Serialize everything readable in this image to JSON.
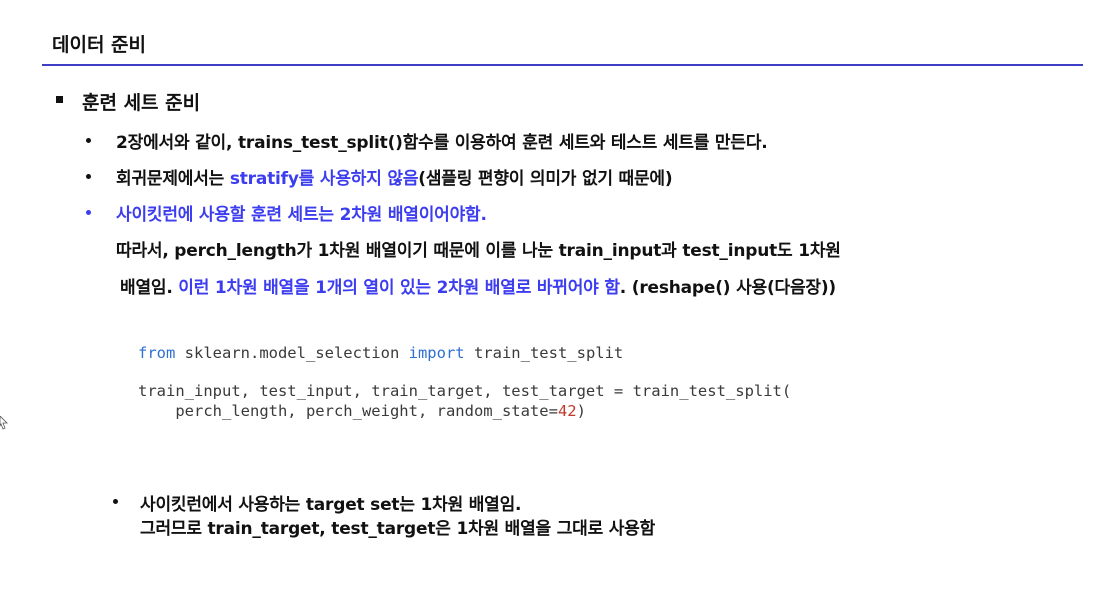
{
  "slide": {
    "title": "데이터 준비",
    "section_heading": "훈련 세트 준비"
  },
  "bullets": {
    "b1": "2장에서와 같이, trains_test_split()함수를 이용하여 훈련 세트와 테스트 세트를 만든다.",
    "b2_before": "회귀문제에서는 ",
    "b2_highlight": "stratify를 사용하지 않음",
    "b2_after": "(샘플링 편향이 의미가 없기 때문에)",
    "b3": "사이킷런에 사용할 훈련 세트는 2차원 배열이어야함.",
    "b3_cont1": "따라서, perch_length가 1차원 배열이기 때문에 이를 나눈 train_input과 test_input도 1차원",
    "b3_cont2_before": "배열임. ",
    "b3_cont2_highlight": "이런 1차원 배열을 1개의 열이 있는 2차원 배열로 바뀌어야 함",
    "b3_cont2_after": ". (reshape() 사용(다음장))"
  },
  "code": {
    "l1_kw1": "from",
    "l1_mid": " sklearn.model_selection ",
    "l1_kw2": "import",
    "l1_end": " train_test_split",
    "l2": "train_input, test_input, train_target, test_target = train_test_split(",
    "l3_start": "    perch_length, perch_weight, random_state=",
    "l3_num": "42",
    "l3_end": ")"
  },
  "note": {
    "line1": "사이킷런에서 사용하는 target set는 1차원 배열임.",
    "line2": "그러므로 train_target, test_target은 1차원 배열을 그대로 사용함"
  },
  "colors": {
    "accent_blue": "#3d3df0",
    "rule_blue": "#3d3dc8",
    "keyword_blue": "#2f6fd0",
    "number_red": "#c0392b"
  }
}
